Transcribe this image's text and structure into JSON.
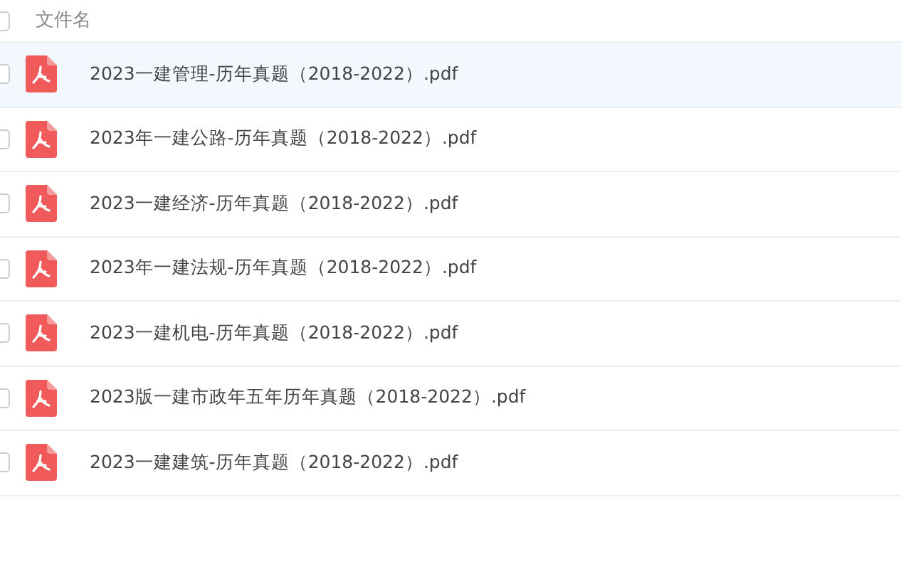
{
  "header": {
    "label": "文件名",
    "checked": false
  },
  "files": [
    {
      "name": "2023一建管理-历年真题（2018-2022）.pdf",
      "selected": true,
      "checked": false
    },
    {
      "name": "2023年一建公路-历年真题（2018-2022）.pdf",
      "selected": false,
      "checked": false
    },
    {
      "name": "2023一建经济-历年真题（2018-2022）.pdf",
      "selected": false,
      "checked": false
    },
    {
      "name": "2023年一建法规-历年真题（2018-2022）.pdf",
      "selected": false,
      "checked": false
    },
    {
      "name": "2023一建机电-历年真题（2018-2022）.pdf",
      "selected": false,
      "checked": false
    },
    {
      "name": "2023版一建市政年五年历年真题（2018-2022）.pdf",
      "selected": false,
      "checked": false
    },
    {
      "name": "2023一建建筑-历年真题（2018-2022）.pdf",
      "selected": false,
      "checked": false
    }
  ]
}
